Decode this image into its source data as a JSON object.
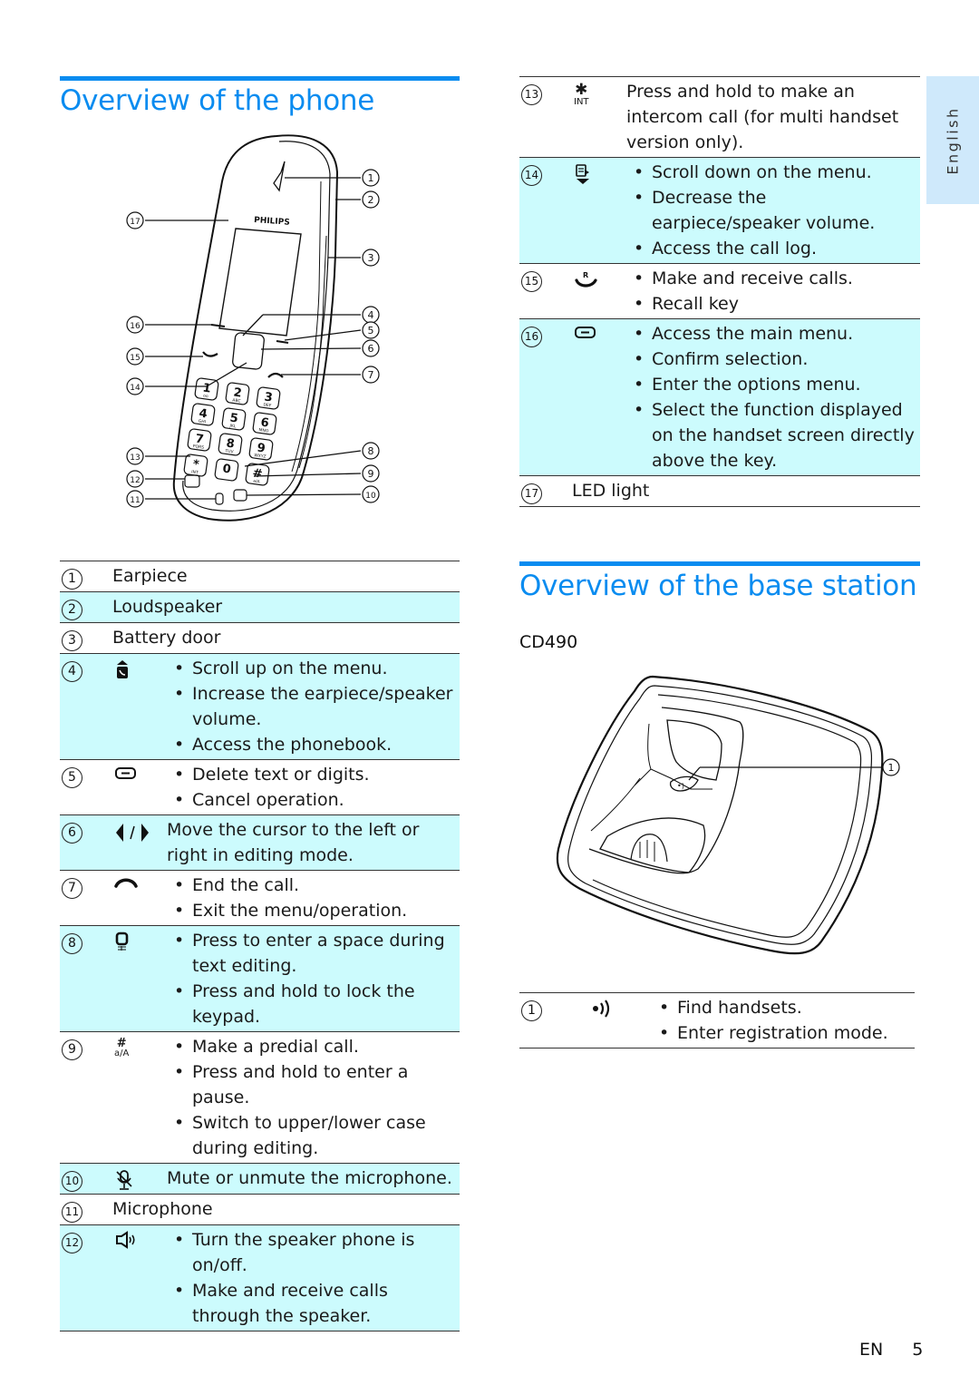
{
  "side_tab": {
    "language": "English"
  },
  "phone_section": {
    "title": "Overview of the phone",
    "figure": {
      "brand": "PHILIPS",
      "callouts_left": [
        "17",
        "16",
        "15",
        "14",
        "13",
        "12",
        "11"
      ],
      "callouts_right": [
        "1",
        "2",
        "3",
        "4",
        "5",
        "6",
        "7",
        "8",
        "9",
        "10"
      ],
      "keypad": [
        {
          "digit": "1",
          "letters": "oo"
        },
        {
          "digit": "2",
          "letters": "ABC"
        },
        {
          "digit": "3",
          "letters": "DEF"
        },
        {
          "digit": "4",
          "letters": "GHI"
        },
        {
          "digit": "5",
          "letters": "JKL"
        },
        {
          "digit": "6",
          "letters": "MNO"
        },
        {
          "digit": "7",
          "letters": "PQRS"
        },
        {
          "digit": "8",
          "letters": "TUV"
        },
        {
          "digit": "9",
          "letters": "WXYZ"
        },
        {
          "digit": "*",
          "letters": "INT"
        },
        {
          "digit": "0",
          "letters": ""
        },
        {
          "digit": "#",
          "letters": "a/A"
        }
      ]
    },
    "parts": [
      {
        "num": "1",
        "label": "Earpiece",
        "shaded": false
      },
      {
        "num": "2",
        "label": "Loudspeaker",
        "shaded": true
      },
      {
        "num": "3",
        "label": "Battery door",
        "shaded": false
      },
      {
        "num": "4",
        "icon": "phonebook-up-icon",
        "shaded": true,
        "bullets": [
          "Scroll up on the menu.",
          "Increase the earpiece/speaker volume.",
          "Access the phonebook."
        ]
      },
      {
        "num": "5",
        "icon": "soft-key-icon",
        "shaded": false,
        "bullets": [
          "Delete text or digits.",
          "Cancel operation."
        ]
      },
      {
        "num": "6",
        "icon": "left-right-arrows-icon",
        "shaded": true,
        "text": "Move the cursor to the left or right in editing mode."
      },
      {
        "num": "7",
        "icon": "end-call-icon",
        "shaded": false,
        "bullets": [
          "End the call.",
          "Exit the menu/operation."
        ]
      },
      {
        "num": "8",
        "icon": "zero-lock-key-icon",
        "shaded": true,
        "bullets": [
          "Press to enter a space during text editing.",
          "Press and hold to lock the keypad."
        ]
      },
      {
        "num": "9",
        "icon": "hash-key-icon",
        "icon_text": {
          "top": "#",
          "bottom": "a/A"
        },
        "shaded": false,
        "bullets": [
          "Make a predial call.",
          "Press and hold to enter a pause.",
          "Switch to upper/lower case during editing."
        ]
      },
      {
        "num": "10",
        "icon": "mute-microphone-icon",
        "shaded": true,
        "text": "Mute or unmute the microphone."
      },
      {
        "num": "11",
        "label": "Microphone",
        "shaded": false
      },
      {
        "num": "12",
        "icon": "speaker-icon",
        "shaded": true,
        "bullets": [
          "Turn the speaker phone is on/off.",
          "Make and receive calls through the speaker."
        ]
      }
    ],
    "parts_continued": [
      {
        "num": "13",
        "icon": "star-int-key-icon",
        "icon_text": {
          "top": "✱",
          "bottom": "INT"
        },
        "shaded": false,
        "text": "Press and hold to make an intercom call (for multi handset version only)."
      },
      {
        "num": "14",
        "icon": "calllog-down-icon",
        "shaded": true,
        "bullets": [
          "Scroll down on the menu.",
          "Decrease the earpiece/speaker volume.",
          "Access the call log."
        ]
      },
      {
        "num": "15",
        "icon": "talk-recall-icon",
        "shaded": false,
        "bullets": [
          "Make and receive calls.",
          "Recall key"
        ]
      },
      {
        "num": "16",
        "icon": "soft-key-icon",
        "shaded": true,
        "bullets": [
          "Access the main menu.",
          "Confirm selection.",
          "Enter the options menu.",
          "Select the function displayed on the handset screen directly above the key."
        ]
      },
      {
        "num": "17",
        "label": "LED light",
        "shaded": false
      }
    ]
  },
  "base_section": {
    "title": "Overview of the base station",
    "model": "CD490",
    "figure": {
      "callouts": [
        "1"
      ]
    },
    "parts": [
      {
        "num": "1",
        "icon": "paging-icon",
        "shaded": false,
        "bullets": [
          "Find handsets.",
          "Enter registration mode."
        ]
      }
    ]
  },
  "footer": {
    "language_code": "EN",
    "page_number": "5"
  }
}
